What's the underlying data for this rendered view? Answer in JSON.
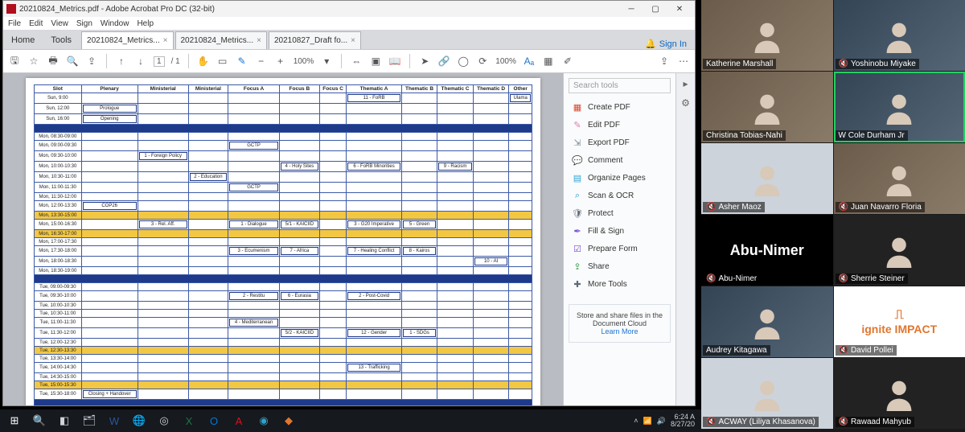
{
  "acrobat": {
    "title": "20210824_Metrics.pdf - Adobe Acrobat Pro DC (32-bit)",
    "menu": [
      "File",
      "Edit",
      "View",
      "Sign",
      "Window",
      "Help"
    ],
    "home": "Home",
    "tools": "Tools",
    "tabs": [
      {
        "label": "20210824_Metrics...",
        "active": true
      },
      {
        "label": "20210824_Metrics...",
        "active": false
      },
      {
        "label": "20210827_Draft fo...",
        "active": false
      }
    ],
    "signin": "Sign In",
    "page_current": "1",
    "page_sep": "/ 1",
    "zoom": "100%",
    "toolpane": {
      "search_placeholder": "Search tools",
      "items": [
        {
          "icon": "create-pdf-icon",
          "color": "#e0452c",
          "label": "Create PDF"
        },
        {
          "icon": "edit-pdf-icon",
          "color": "#e07ab2",
          "label": "Edit PDF"
        },
        {
          "icon": "export-pdf-icon",
          "color": "#7b8896",
          "label": "Export PDF"
        },
        {
          "icon": "comment-icon",
          "color": "#b58b1c",
          "label": "Comment"
        },
        {
          "icon": "organize-icon",
          "color": "#2fa3d6",
          "label": "Organize Pages"
        },
        {
          "icon": "scan-ocr-icon",
          "color": "#2a9ad6",
          "label": "Scan & OCR"
        },
        {
          "icon": "protect-icon",
          "color": "#5f6b78",
          "label": "Protect"
        },
        {
          "icon": "fill-sign-icon",
          "color": "#7a4fd1",
          "label": "Fill & Sign"
        },
        {
          "icon": "prepare-form-icon",
          "color": "#7a4fd1",
          "label": "Prepare Form"
        },
        {
          "icon": "share-icon",
          "color": "#1f8f3b",
          "label": "Share"
        },
        {
          "icon": "more-tools-icon",
          "color": "#5f6b78",
          "label": "More Tools"
        }
      ],
      "cloud_text": "Store and share files in the Document Cloud",
      "cloud_link": "Learn More"
    }
  },
  "schedule": {
    "headers": [
      "Slot",
      "Plenary",
      "Ministerial",
      "Ministerial",
      "Focus A",
      "Focus B",
      "Focus C",
      "Thematic A",
      "Thematic B",
      "Thematic C",
      "Thematic D",
      "Other"
    ],
    "rows": [
      {
        "slot": "Sun, 9:00",
        "cells": [
          "",
          "",
          "",
          "",
          "",
          "",
          "11 - FoRB",
          "",
          "",
          "",
          ""
        ]
      },
      {
        "slot": "Sun, 12:00",
        "cells": [
          "Prologue",
          "",
          "",
          "",
          "",
          "",
          "",
          "",
          "",
          "",
          ""
        ]
      },
      {
        "slot": "Sun, 16:00",
        "cells": [
          "Opening",
          "",
          "",
          "",
          "",
          "",
          "",
          "",
          "",
          "",
          ""
        ]
      },
      {
        "type": "blue"
      },
      {
        "slot": "Mon, 08:30-09:00",
        "cells": [
          "",
          "",
          "",
          "",
          "",
          "",
          "",
          "",
          "",
          "",
          ""
        ]
      },
      {
        "slot": "Mon, 09:00-09:30",
        "cells": [
          "",
          "",
          "",
          "GCTP",
          "",
          "",
          "",
          "",
          "",
          "",
          ""
        ]
      },
      {
        "slot": "Mon, 09:30-10:00",
        "cells": [
          "",
          "1 - Foreign Policy",
          "",
          "",
          "",
          "",
          "",
          "",
          "",
          "",
          ""
        ]
      },
      {
        "slot": "Mon, 10:00-10:30",
        "cells": [
          "",
          "",
          "",
          "",
          "4 - Holy Sites",
          "",
          "6 - FoRB Minorities",
          "",
          "9 - Racism",
          "",
          ""
        ]
      },
      {
        "slot": "Mon, 10:30-11:00",
        "cells": [
          "",
          "",
          "2 - Education",
          "",
          "",
          "",
          "",
          "",
          "",
          "",
          ""
        ]
      },
      {
        "slot": "Mon, 11:00-11:30",
        "cells": [
          "",
          "",
          "",
          "GCTP",
          "",
          "",
          "",
          "",
          "",
          "",
          ""
        ]
      },
      {
        "slot": "Mon, 11:30-12:00",
        "cells": [
          "",
          "",
          "",
          "",
          "",
          "",
          "",
          "",
          "",
          "",
          ""
        ]
      },
      {
        "slot": "Mon, 12:00-13:30",
        "cells": [
          "COP26",
          "",
          "",
          "",
          "",
          "",
          "",
          "",
          "",
          "",
          ""
        ]
      },
      {
        "type": "gold",
        "slot": "Mon, 13:30-15:00",
        "cells": [
          "",
          "",
          "",
          "",
          "",
          "",
          "",
          "",
          "",
          "",
          ""
        ]
      },
      {
        "slot": "Mon, 15:00-16:30",
        "cells": [
          "",
          "3 - Rel. Aff.",
          "",
          "1 - Dialogue",
          "5/1 - KAICIID",
          "",
          "3 - G20 Imperative",
          "5 - Green",
          "",
          "",
          ""
        ]
      },
      {
        "type": "gold",
        "slot": "Mon, 16:30-17:00",
        "cells": [
          "",
          "",
          "",
          "",
          "",
          "",
          "",
          "",
          "",
          "",
          ""
        ]
      },
      {
        "slot": "Mon, 17:00-17:30",
        "cells": [
          "",
          "",
          "",
          "",
          "",
          "",
          "",
          "",
          "",
          "",
          ""
        ]
      },
      {
        "slot": "Mon, 17:30-18:00",
        "cells": [
          "",
          "",
          "",
          "3 - Ecumenism",
          "7 - Africa",
          "",
          "7 - Healing Conflict",
          "8 - Kairos",
          "",
          "",
          ""
        ]
      },
      {
        "slot": "Mon, 18:00-18:30",
        "cells": [
          "",
          "",
          "",
          "",
          "",
          "",
          "",
          "",
          "",
          "10 - AI",
          ""
        ]
      },
      {
        "slot": "Mon, 18:30-19:00",
        "cells": [
          "",
          "",
          "",
          "",
          "",
          "",
          "",
          "",
          "",
          "",
          ""
        ]
      },
      {
        "type": "blue"
      },
      {
        "slot": "Tue, 09:00-09:30",
        "cells": [
          "",
          "",
          "",
          "",
          "",
          "",
          "",
          "",
          "",
          "",
          ""
        ]
      },
      {
        "slot": "Tue, 09:30-10:00",
        "cells": [
          "",
          "",
          "",
          "2 - Restitu",
          "6 - Eurasia",
          "",
          "2 - Post-Covid",
          "",
          "",
          "",
          ""
        ]
      },
      {
        "slot": "Tue, 10:00-10:30",
        "cells": [
          "",
          "",
          "",
          "",
          "",
          "",
          "",
          "",
          "",
          "",
          ""
        ]
      },
      {
        "slot": "Tue, 10:30-11:00",
        "cells": [
          "",
          "",
          "",
          "",
          "",
          "",
          "",
          "",
          "",
          "",
          ""
        ]
      },
      {
        "slot": "Tue, 11:00-11:30",
        "cells": [
          "",
          "",
          "",
          "4 - Mediterranean",
          "",
          "",
          "",
          "",
          "",
          "",
          ""
        ]
      },
      {
        "slot": "Tue, 11:30-12:00",
        "cells": [
          "",
          "",
          "",
          "",
          "5/2 - KAICIID",
          "",
          "12 - Gender",
          "1 - SDGs",
          "",
          "",
          ""
        ]
      },
      {
        "slot": "Tue, 12:00-12:30",
        "cells": [
          "",
          "",
          "",
          "",
          "",
          "",
          "",
          "",
          "",
          "",
          ""
        ]
      },
      {
        "type": "gold",
        "slot": "Tue, 12:30-13:30",
        "cells": [
          "",
          "",
          "",
          "",
          "",
          "",
          "",
          "",
          "",
          "",
          ""
        ]
      },
      {
        "slot": "Tue, 13:30-14:00",
        "cells": [
          "",
          "",
          "",
          "",
          "",
          "",
          "",
          "",
          "",
          "",
          ""
        ]
      },
      {
        "slot": "Tue, 14:00-14:30",
        "cells": [
          "",
          "",
          "",
          "",
          "",
          "",
          "13 - Trafficking",
          "",
          "",
          "",
          ""
        ]
      },
      {
        "slot": "Tue, 14:30-15:00",
        "cells": [
          "",
          "",
          "",
          "",
          "",
          "",
          "",
          "",
          "",
          "",
          ""
        ]
      },
      {
        "type": "gold",
        "slot": "Tue, 15:00-15:30",
        "cells": [
          "",
          "",
          "",
          "",
          "",
          "",
          "",
          "",
          "",
          "",
          ""
        ]
      },
      {
        "slot": "Tue, 15:30-18:00",
        "cells": [
          "Closing + Handover",
          "",
          "",
          "",
          "",
          "",
          "",
          "",
          "",
          "",
          ""
        ]
      },
      {
        "type": "blue"
      }
    ],
    "ulama": "Ulama"
  },
  "participants": [
    {
      "name": "Katherine Marshall",
      "muted": false,
      "thumb": "room",
      "speaking": false
    },
    {
      "name": "Yoshinobu Miyake",
      "muted": true,
      "thumb": "office",
      "speaking": false
    },
    {
      "name": "Christina Tobias-Nahi",
      "muted": false,
      "thumb": "room",
      "speaking": false
    },
    {
      "name": "W Cole Durham Jr",
      "muted": false,
      "thumb": "office",
      "speaking": true
    },
    {
      "name": "Asher Maoz",
      "muted": true,
      "thumb": "light",
      "speaking": false
    },
    {
      "name": "Juan Navarro Floria",
      "muted": true,
      "thumb": "room",
      "speaking": false
    },
    {
      "name": "Abu-Nimer",
      "muted": true,
      "thumb": "text-only",
      "text": "Abu-Nimer",
      "speaking": false
    },
    {
      "name": "Sherrie Steiner",
      "muted": true,
      "thumb": "plain",
      "speaking": false
    },
    {
      "name": "Audrey Kitagawa",
      "muted": false,
      "thumb": "office",
      "speaking": false
    },
    {
      "name": "David Pollei",
      "muted": true,
      "thumb": "logo",
      "text": "ignite IMPACT",
      "speaking": false
    },
    {
      "name": "ACWAY (Liliya Khasanova)",
      "muted": true,
      "thumb": "light",
      "speaking": false
    },
    {
      "name": "Rawaad Mahyub",
      "muted": true,
      "thumb": "plain",
      "speaking": false
    }
  ],
  "taskbar": {
    "time": "6:24 A",
    "date": "8/27/20"
  }
}
